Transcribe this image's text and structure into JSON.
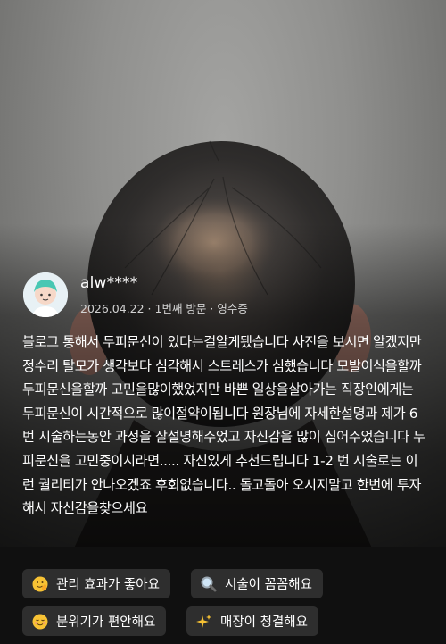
{
  "review": {
    "username": "alw****",
    "meta": "2026.04.22 · 1번째 방문 · 영수증",
    "text": "블로그 통해서 두피문신이 있다는걸알게됐습니다 사진을 보시면 알겠지만 정수리 탈모가 생각보다 심각해서 스트레스가 심했습니다 모발이식을할까 두피문신을할까 고민을많이했었지만 바쁜 일상을살아가는 직장인에게는 두피문신이 시간적으로 많이절약이됩니다 원장님에 자세한설명과 제가 6번 시술하는동안 과정을 잘설명해주었고 자신감을 많이 심어주었습니다 두피문신을 고민중이시라면..... 자신있게 추천드립니다 1-2 번 시술로는 이런 퀄리티가 안나오겠죠 후회없습니다.. 돌고돌아 오시지말고 한번에 투자해서 자신감을찾으세요"
  },
  "keywords": [
    {
      "icon": "thumbs-up-emoji-icon",
      "label": "관리 효과가 좋아요"
    },
    {
      "icon": "magnifier-icon",
      "label": "시술이 꼼꼼해요"
    },
    {
      "icon": "relieved-face-emoji-icon",
      "label": "분위기가 편안해요"
    },
    {
      "icon": "sparkles-icon",
      "label": "매장이 청결해요"
    }
  ],
  "colors": {
    "chip_bg": "#2e2e2e",
    "bottom_bg": "#101010",
    "text": "#ffffff",
    "meta": "#d2d2d2"
  }
}
